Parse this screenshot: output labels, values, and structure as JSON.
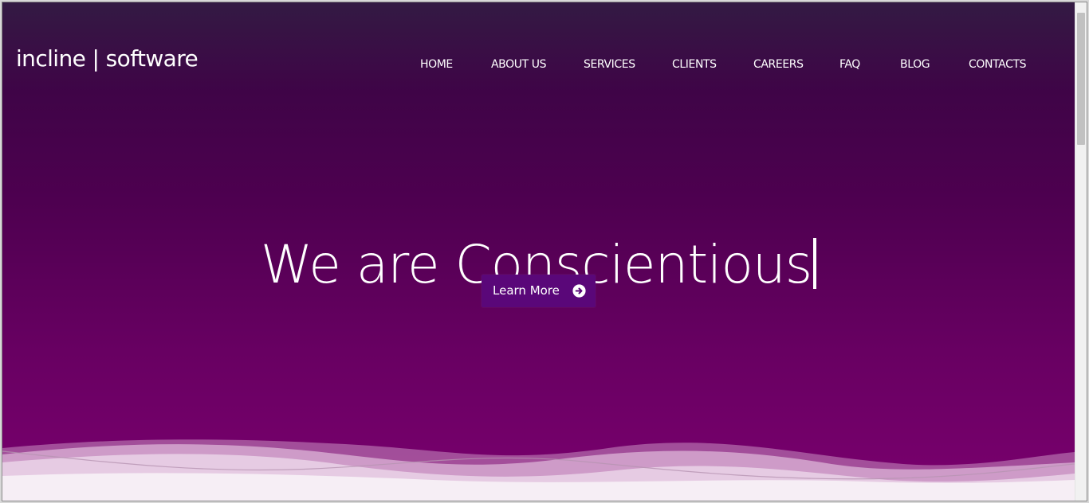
{
  "site": {
    "logo": "incline | software"
  },
  "nav": {
    "items": [
      {
        "label": "HOME"
      },
      {
        "label": "ABOUT US"
      },
      {
        "label": "SERVICES"
      },
      {
        "label": "CLIENTS"
      },
      {
        "label": "CAREERS"
      },
      {
        "label": "FAQ"
      },
      {
        "label": "BLOG"
      },
      {
        "label": "CONTACTS"
      }
    ]
  },
  "hero": {
    "headline": "We are Conscientious",
    "cta_label": "Learn More",
    "cta_icon": "arrow-circle-right-icon"
  },
  "colors": {
    "hero_top": "#331a43",
    "hero_bottom": "#7a006e",
    "button": "#5a0779",
    "text": "#ffffff"
  }
}
